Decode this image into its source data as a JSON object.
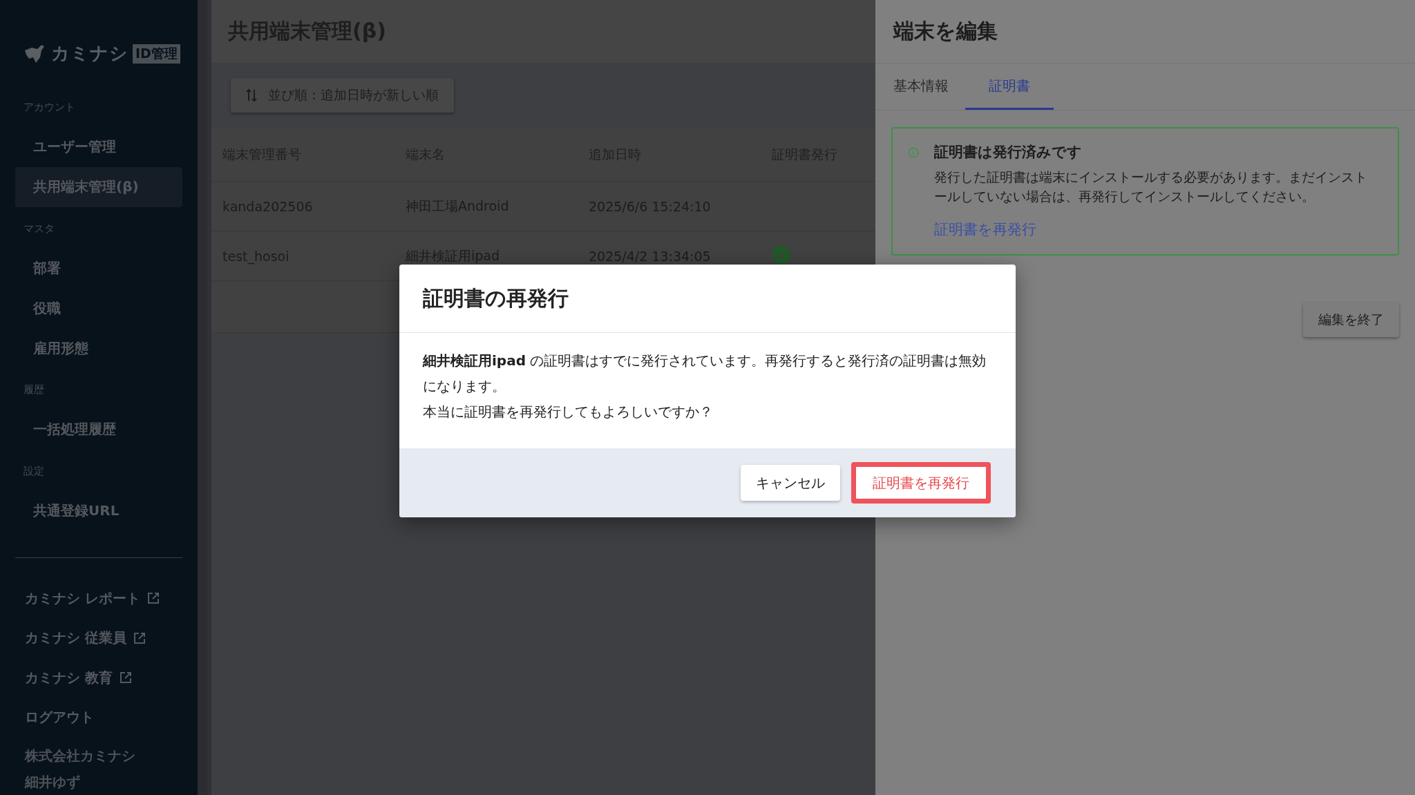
{
  "sidebar": {
    "logo": {
      "name": "カミナシ",
      "badge": "ID管理"
    },
    "sections": [
      {
        "label": "アカウント",
        "items": [
          {
            "label": "ユーザー管理",
            "selected": false
          },
          {
            "label": "共用端末管理(β)",
            "selected": true
          }
        ]
      },
      {
        "label": "マスタ",
        "items": [
          {
            "label": "部署",
            "selected": false
          },
          {
            "label": "役職",
            "selected": false
          },
          {
            "label": "雇用形態",
            "selected": false
          }
        ]
      },
      {
        "label": "履歴",
        "items": [
          {
            "label": "一括処理履歴",
            "selected": false
          }
        ]
      },
      {
        "label": "設定",
        "items": [
          {
            "label": "共通登録URL",
            "selected": false
          }
        ]
      }
    ],
    "links": [
      {
        "label": "カミナシ レポート",
        "external": true
      },
      {
        "label": "カミナシ 従業員",
        "external": true
      },
      {
        "label": "カミナシ 教育",
        "external": true
      },
      {
        "label": "ログアウト",
        "external": false
      }
    ],
    "account": {
      "company": "株式会社カミナシ",
      "user": "細井ゆず"
    }
  },
  "main": {
    "title": "共用端末管理(β)",
    "sort_button": "並び順：追加日時が新しい順",
    "table": {
      "columns": [
        "端末管理番号",
        "端末名",
        "追加日時",
        "証明書発行"
      ],
      "rows": [
        {
          "cells": [
            "kanda202506",
            "神田工場Android",
            "2025/6/6 15:24:10"
          ],
          "cert_issued": false
        },
        {
          "cells": [
            "test_hosoi",
            "細井検証用ipad",
            "2025/4/2 13:34:05"
          ],
          "cert_issued": true
        }
      ]
    }
  },
  "edit_panel": {
    "title": "端末を編集",
    "tabs": [
      {
        "label": "基本情報",
        "selected": false
      },
      {
        "label": "証明書",
        "selected": true
      }
    ],
    "notice": {
      "title": "証明書は発行済みです",
      "text": "発行した証明書は端末にインストールする必要があります。まだインストールしていない場合は、再発行してインストールしてください。",
      "link": "証明書を再発行"
    },
    "finish_button": "編集を終了"
  },
  "dialog": {
    "title": "証明書の再発行",
    "paragraphs": [
      "**細井検証用ipad** の証明書はすでに発行されています。再発行すると発行済の証明書は無効になります。",
      "本当に証明書を再発行してもよろしいですか？"
    ],
    "buttons": [
      {
        "label": "キャンセル",
        "kind": "secondary",
        "highlighted": false
      },
      {
        "label": "証明書を再発行",
        "kind": "danger",
        "highlighted": true
      }
    ]
  }
}
